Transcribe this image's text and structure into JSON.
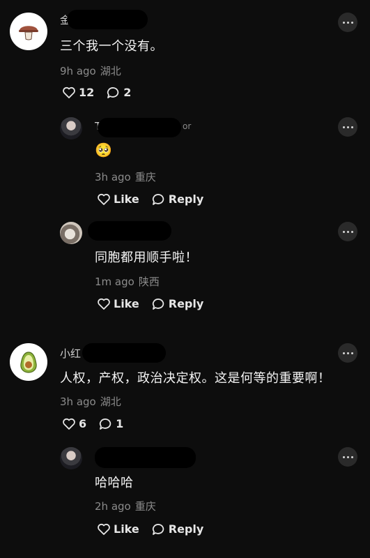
{
  "like_label": "Like",
  "reply_label": "Reply",
  "comments": [
    {
      "username_prefix": "金",
      "text": "三个我一个没有。",
      "time": "9h ago",
      "location": "湖北",
      "likes": "12",
      "replies": "2",
      "avatar": "mushroom-icon"
    },
    {
      "username_prefix": "T",
      "username_suffix": "or",
      "text": "🥺",
      "time": "3h ago",
      "location": "重庆"
    },
    {
      "username_prefix": "",
      "text": "同胞都用顺手啦！",
      "time": "1m ago",
      "location": "陕西"
    },
    {
      "username_prefix": "小红",
      "text": "人权，产权，政治决定权。这是何等的重要啊！",
      "time": "3h ago",
      "location": "湖北",
      "likes": "6",
      "replies": "1",
      "avatar": "avocado-icon"
    },
    {
      "username_prefix": "",
      "text": "哈哈哈",
      "time": "2h ago",
      "location": "重庆"
    }
  ]
}
